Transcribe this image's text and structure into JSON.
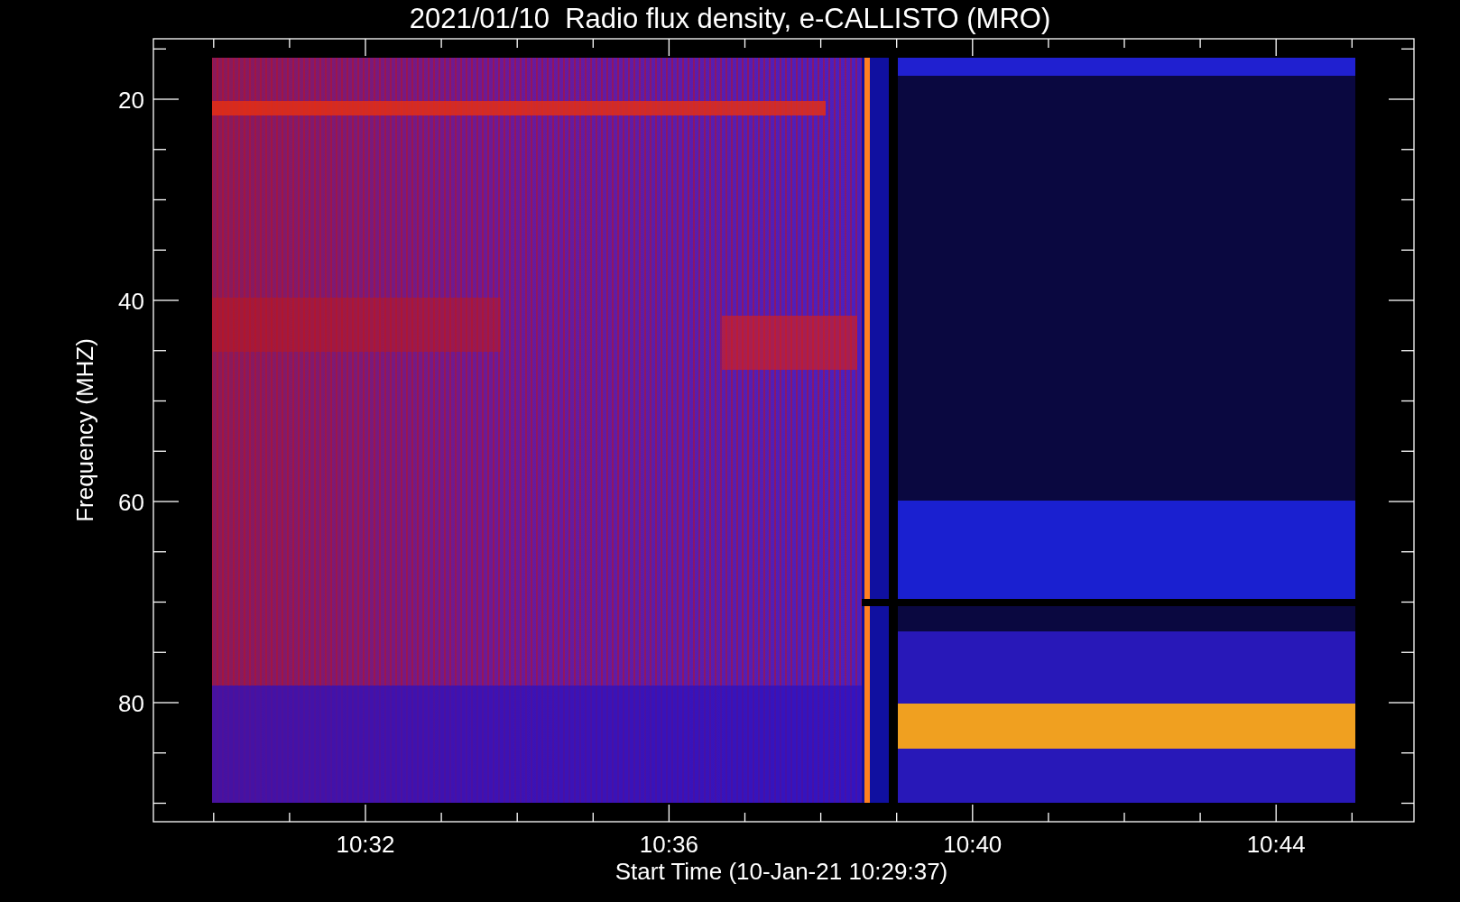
{
  "title": "2021/01/10  Radio flux density, e-CALLISTO (MRO)",
  "plot": {
    "ylabel": "Frequency (MHZ)",
    "xlabel": "Start Time (10-Jan-21 10:29:37)",
    "yticks": [
      "20",
      "40",
      "60",
      "80"
    ],
    "xticks": [
      "10:32",
      "10:36",
      "10:40",
      "10:44"
    ]
  }
}
